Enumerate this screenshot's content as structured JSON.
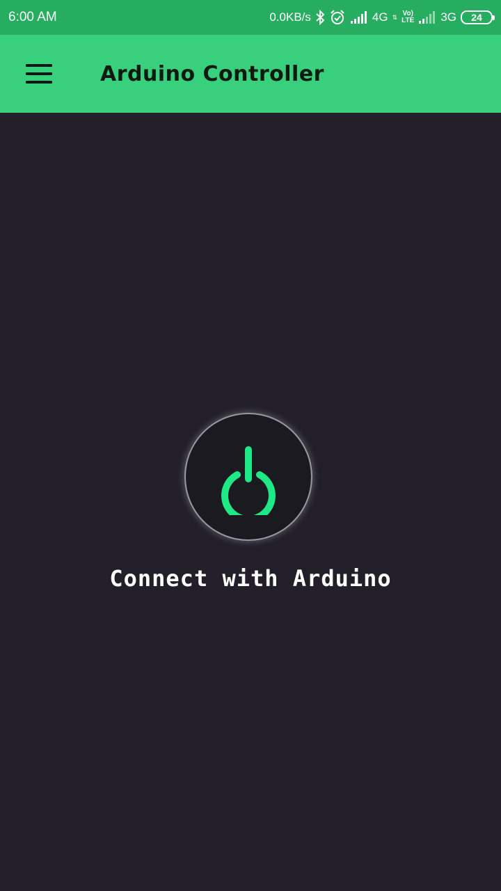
{
  "status_bar": {
    "time": "6:00 AM",
    "network_speed": "0.0KB/s",
    "icons": [
      "bluetooth-icon",
      "alarm-icon",
      "signal-icon",
      "signal-icon"
    ],
    "network_1": "4G",
    "network_1_sub": "⇅",
    "volte_top": "Vo)",
    "volte_bottom": "LTE",
    "network_2": "3G",
    "battery": "24"
  },
  "app_bar": {
    "title": "Arduino Controller",
    "menu_icon": "hamburger-menu-icon",
    "background": "#38d07c"
  },
  "main": {
    "power_icon": "power-icon",
    "connect_label": "Connect with Arduino",
    "accent": "#1fe886",
    "background": "#221f2b"
  }
}
